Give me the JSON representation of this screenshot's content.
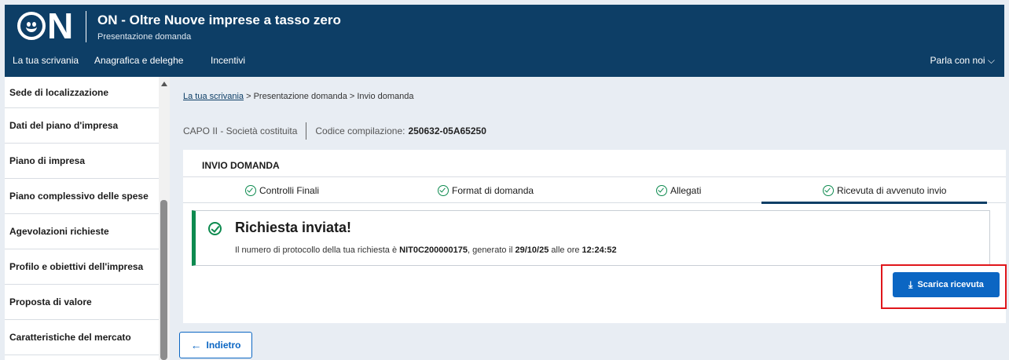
{
  "header": {
    "logo_letter": "N",
    "title": "ON - Oltre Nuove imprese a tasso zero",
    "subtitle": "Presentazione domanda",
    "nav": [
      "La tua scrivania",
      "Anagrafica e deleghe",
      "Incentivi"
    ],
    "talk": "Parla con noi ⌵"
  },
  "sidebar": {
    "items": [
      "Sede di localizzazione",
      "Dati del piano d'impresa",
      "Piano di impresa",
      "Piano complessivo delle spese",
      "Agevolazioni richieste",
      "Profilo e obiettivi dell'impresa",
      "Proposta di valore",
      "Caratteristiche del mercato"
    ]
  },
  "breadcrumb": {
    "home": "La tua scrivania",
    "rest": " > Presentazione domanda > Invio domanda"
  },
  "meta": {
    "capo": "CAPO II - Società costituita",
    "code_label": "Codice compilazione:",
    "code_value": "250632-05A65250"
  },
  "card": {
    "title": "INVIO DOMANDA",
    "tabs": [
      "Controlli Finali",
      "Format di domanda",
      "Allegati",
      "Ricevuta di avvenuto invio"
    ]
  },
  "alert": {
    "title": "Richiesta inviata!",
    "text_1": "Il numero di protocollo della tua richiesta è ",
    "protocol": "NIT0C200000175",
    "text_2": ", generato il ",
    "date": "29/10/25",
    "text_3": " alle ore ",
    "time": "12:24:52"
  },
  "buttons": {
    "download": "Scarica ricevuta",
    "back": "Indietro"
  },
  "colors": {
    "header_bg": "#0d3e66",
    "success": "#0d8a4f",
    "primary": "#0b66c3",
    "highlight": "#e0161b"
  }
}
